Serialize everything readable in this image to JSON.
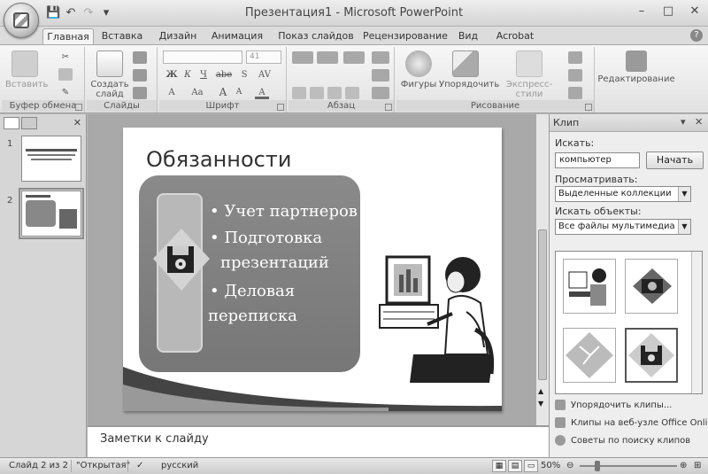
{
  "title_bar": {
    "title": "Презентация1 - Microsoft PowerPoint",
    "qat": {
      "save": "💾",
      "undo": "↶",
      "redo": "↷",
      "customize": "▾"
    },
    "controls": {
      "minimize": "–",
      "maximize": "□",
      "close": "✕"
    }
  },
  "ribbon_tabs": [
    {
      "label": "Главная"
    },
    {
      "label": "Вставка"
    },
    {
      "label": "Дизайн"
    },
    {
      "label": "Анимация"
    },
    {
      "label": "Показ слайдов"
    },
    {
      "label": "Рецензирование"
    },
    {
      "label": "Вид"
    },
    {
      "label": "Acrobat"
    }
  ],
  "ribbon": {
    "clipboard": {
      "paste": "Вставить",
      "group": "Буфер обмена"
    },
    "slides": {
      "new_slide": "Создать слайд",
      "group": "Слайды"
    },
    "font": {
      "size": "41",
      "group": "Шрифт",
      "bold": "Ж",
      "italic": "К",
      "underline": "Ч",
      "strike": "abe",
      "shadow": "S",
      "spacing": "AV",
      "case": "Aa",
      "grow": "A",
      "shrink": "A"
    },
    "paragraph": {
      "group": "Абзац"
    },
    "drawing": {
      "shapes": "Фигуры",
      "arrange": "Упорядочить",
      "quick_styles": "Экспресс-стили",
      "group": "Рисование"
    },
    "editing": {
      "label": "Редактирование"
    }
  },
  "slides_panel": {
    "thumbs": [
      {
        "num": "1",
        "text": "Организация труда с компьютером"
      },
      {
        "num": "2",
        "text": "Обязанности"
      }
    ]
  },
  "slide": {
    "title": "Обязанности",
    "bullets": [
      "• Учет партнеров",
      "• Подготовка",
      "презентаций",
      "• Деловая",
      "переписка"
    ]
  },
  "notes": {
    "placeholder": "Заметки к слайду"
  },
  "clip_pane": {
    "title": "Клип",
    "search_label": "Искать:",
    "search_value": "компьютер",
    "go_button": "Начать",
    "browse_label": "Просматривать:",
    "browse_value": "Выделенные коллекции",
    "type_label": "Искать объекты:",
    "type_value": "Все файлы мультимедиа",
    "links": [
      "Упорядочить клипы...",
      "Клипы на веб-узле Office Online",
      "Советы по поиску клипов"
    ]
  },
  "status_bar": {
    "slide": "Слайд 2 из 2",
    "theme": "\"Открытая\"",
    "language": "русский",
    "zoom": "50%"
  }
}
